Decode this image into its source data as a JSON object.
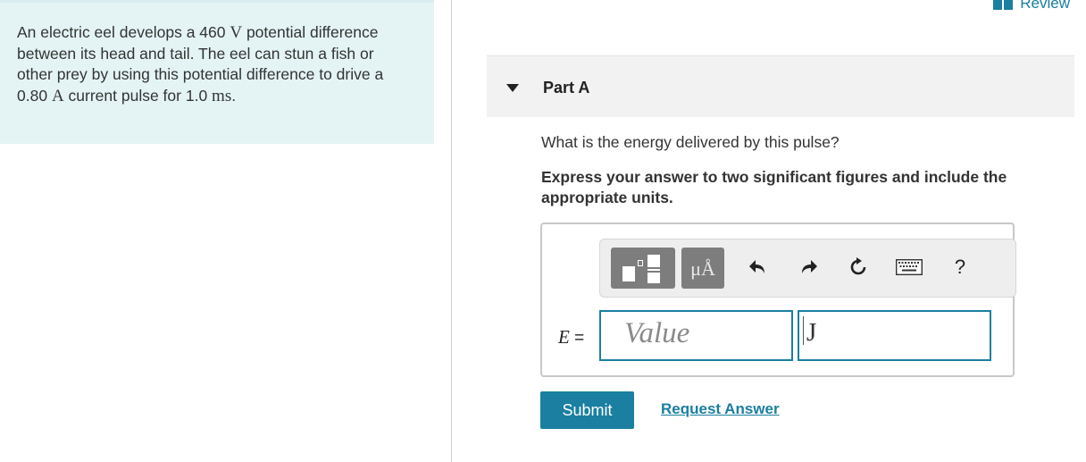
{
  "problem": {
    "text_a": "An electric eel develops a 460 ",
    "unit_v": "V",
    "text_b": " potential difference between its head and tail. The eel can stun a fish or other prey by using this potential difference to drive a 0.80 ",
    "unit_a": "A",
    "text_c": " current pulse for 1.0 ",
    "unit_ms": "ms",
    "text_d": "."
  },
  "header": {
    "review_label": "Review"
  },
  "part": {
    "title": "Part A",
    "question": "What is the energy delivered by this pulse?",
    "instruction": "Express your answer to two significant figures and include the appropriate units."
  },
  "answer": {
    "variable": "E",
    "equals": " =",
    "value_placeholder": "Value",
    "unit_value": "J"
  },
  "toolbar": {
    "units_label": "μÅ",
    "help_label": "?",
    "icons": [
      "templates-icon",
      "units-icon",
      "undo-icon",
      "redo-icon",
      "reset-icon",
      "keyboard-icon",
      "help-icon"
    ]
  },
  "actions": {
    "submit_label": "Submit",
    "request_label": "Request Answer"
  },
  "colors": {
    "accent": "#1a7fa1",
    "problem_bg": "#e4f4f5",
    "toolbar_button": "#7d7d7d"
  }
}
